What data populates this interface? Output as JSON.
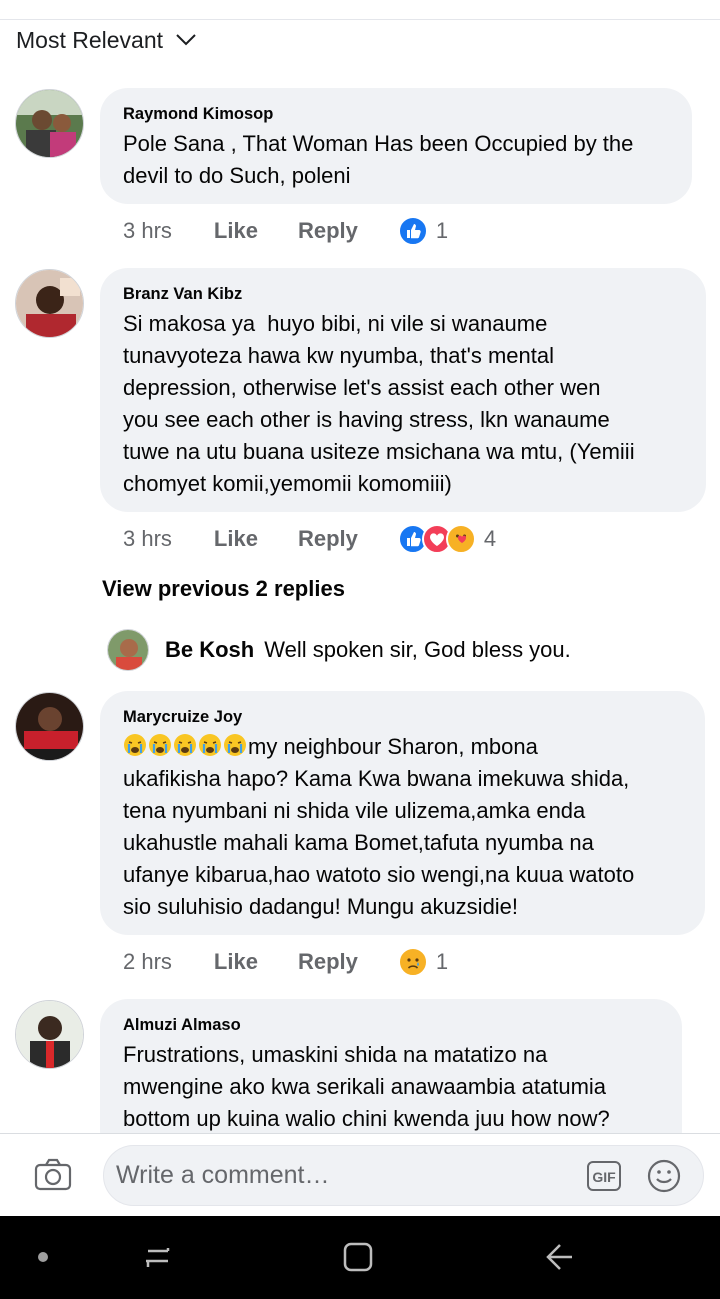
{
  "sort": {
    "label": "Most Relevant"
  },
  "comments": [
    {
      "author": "Raymond Kimosop",
      "text": "Pole Sana , That Woman Has been Occupied by the\ndevil to do Such, poleni",
      "time": "3 hrs",
      "like_label": "Like",
      "reply_label": "Reply",
      "reaction_count": "1",
      "reactions": [
        "like-icon"
      ]
    },
    {
      "author": "Branz Van Kibz",
      "text": "Si makosa ya  huyo bibi, ni vile si wanaume\ntunavyoteza hawa kw nyumba, that's mental\ndepression, otherwise let's assist each other wen\nyou see each other is having stress, lkn wanaume\ntuwe na utu buana usiteze msichana wa mtu, (Yemiii\nchomyet komii,yemomii komomiii)",
      "time": "3 hrs",
      "like_label": "Like",
      "reply_label": "Reply",
      "reaction_count": "4",
      "reactions": [
        "like-icon",
        "love-icon",
        "care-icon"
      ]
    },
    {
      "author": "Marycruize Joy",
      "emoji_prefix": [
        "crying-face-icon",
        "crying-face-icon",
        "crying-face-icon",
        "crying-face-icon",
        "crying-face-icon"
      ],
      "text": "my neighbour Sharon, mbona\nukafikisha hapo? Kama Kwa bwana imekuwa shida,\ntena nyumbani ni shida vile ulizema,amka enda\nukahustle mahali kama Bomet,tafuta nyumba na\nufanye kibarua,hao watoto sio wengi,na kuua watoto\nsio suluhisio dadangu! Mungu akuzsidie!",
      "time": "2 hrs",
      "like_label": "Like",
      "reply_label": "Reply",
      "reaction_count": "1",
      "reactions": [
        "sad-icon"
      ]
    },
    {
      "author": "Almuzi Almaso",
      "text": "Frustrations, umaskini shida na matatizo na\nmwengine ako kwa serikali anawaambia atatumia\nbottom up kuina walio chini kwenda juu how now?"
    }
  ],
  "view_previous": "View previous 2 replies",
  "reply": {
    "author": "Be Kosh",
    "text": "Well spoken sir, God bless you."
  },
  "composer": {
    "placeholder": "Write a comment…"
  },
  "colors": {
    "like_blue": "#1877f2",
    "love_red": "#f33e58",
    "care_yellow": "#f7b125",
    "bubble_bg": "#f0f2f5",
    "meta_gray": "#65676b"
  }
}
